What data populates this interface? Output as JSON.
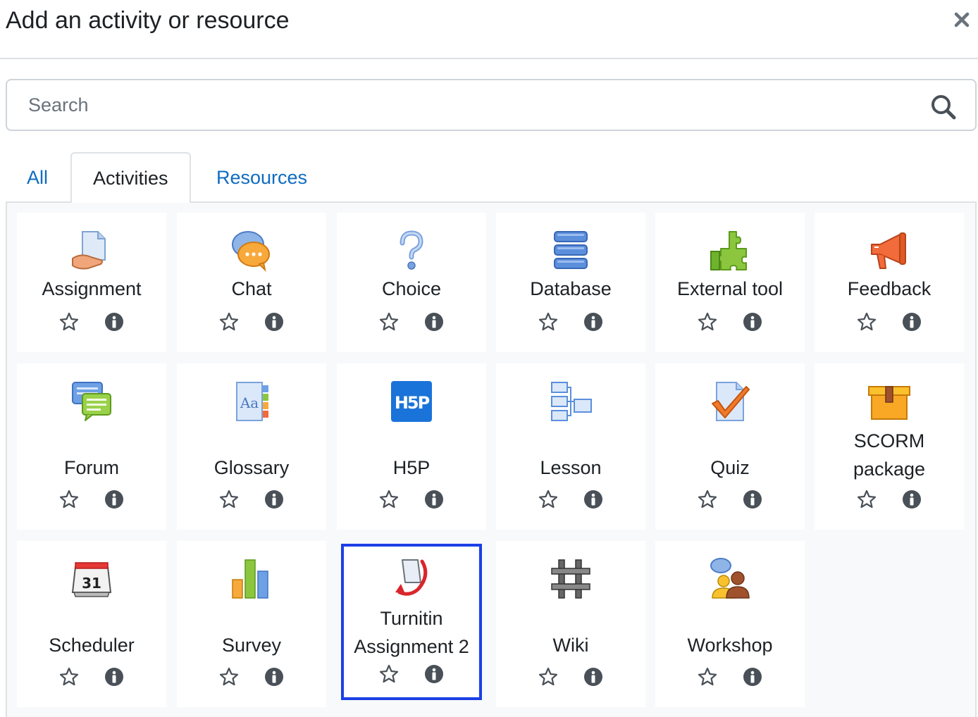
{
  "header": {
    "title": "Add an activity or resource",
    "close_icon": "close-icon"
  },
  "search": {
    "placeholder": "Search",
    "value": ""
  },
  "tabs": [
    {
      "label": "All",
      "active": false
    },
    {
      "label": "Activities",
      "active": true
    },
    {
      "label": "Resources",
      "active": false
    }
  ],
  "modules": [
    {
      "label": "Assignment",
      "icon": "assignment-icon"
    },
    {
      "label": "Chat",
      "icon": "chat-icon"
    },
    {
      "label": "Choice",
      "icon": "choice-icon"
    },
    {
      "label": "Database",
      "icon": "database-icon"
    },
    {
      "label": "External tool",
      "icon": "external-tool-icon"
    },
    {
      "label": "Feedback",
      "icon": "feedback-icon"
    },
    {
      "label": "Forum",
      "icon": "forum-icon"
    },
    {
      "label": "Glossary",
      "icon": "glossary-icon"
    },
    {
      "label": "H5P",
      "icon": "h5p-icon"
    },
    {
      "label": "Lesson",
      "icon": "lesson-icon"
    },
    {
      "label": "Quiz",
      "icon": "quiz-icon"
    },
    {
      "label": "SCORM package",
      "icon": "scorm-icon"
    },
    {
      "label": "Scheduler",
      "icon": "scheduler-icon",
      "icon_text": "31"
    },
    {
      "label": "Survey",
      "icon": "survey-icon"
    },
    {
      "label": "Turnitin Assignment 2",
      "icon": "turnitin-icon",
      "highlighted": true
    },
    {
      "label": "Wiki",
      "icon": "wiki-icon"
    },
    {
      "label": "Workshop",
      "icon": "workshop-icon"
    }
  ],
  "icons": {
    "h5p_text": "H5P",
    "glossary_text": "Aa"
  },
  "colors": {
    "link": "#0f6cbf",
    "highlight": "#1b3fe6",
    "tile_bg": "#ffffff",
    "area_bg": "#f8f9fa"
  }
}
